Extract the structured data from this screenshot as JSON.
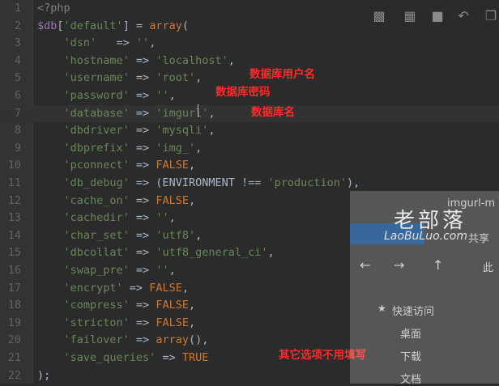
{
  "editor": {
    "lines": [
      {
        "n": "1",
        "parts": [
          {
            "t": "<?php",
            "c": "cmt"
          }
        ]
      },
      {
        "n": "2",
        "parts": [
          {
            "t": "$db",
            "c": "var"
          },
          {
            "t": "[",
            "c": ""
          },
          {
            "t": "'default'",
            "c": "str"
          },
          {
            "t": "] = ",
            "c": ""
          },
          {
            "t": "array",
            "c": "kw"
          },
          {
            "t": "(",
            "c": ""
          }
        ]
      },
      {
        "n": "3",
        "parts": [
          {
            "t": "    'dsn'   ",
            "c": "str"
          },
          {
            "t": "=> ",
            "c": ""
          },
          {
            "t": "''",
            "c": "str"
          },
          {
            "t": ",",
            "c": ""
          }
        ]
      },
      {
        "n": "4",
        "parts": [
          {
            "t": "    'hostname'",
            "c": "str"
          },
          {
            "t": " => ",
            "c": ""
          },
          {
            "t": "'localhost'",
            "c": "str"
          },
          {
            "t": ",",
            "c": ""
          }
        ]
      },
      {
        "n": "5",
        "parts": [
          {
            "t": "    'username'",
            "c": "str"
          },
          {
            "t": " => ",
            "c": ""
          },
          {
            "t": "'root'",
            "c": "str"
          },
          {
            "t": ",",
            "c": ""
          }
        ]
      },
      {
        "n": "6",
        "parts": [
          {
            "t": "    'password'",
            "c": "str"
          },
          {
            "t": " => ",
            "c": ""
          },
          {
            "t": "''",
            "c": "str"
          },
          {
            "t": ",",
            "c": ""
          }
        ]
      },
      {
        "n": "7",
        "parts": [
          {
            "t": "    'database'",
            "c": "str"
          },
          {
            "t": " => ",
            "c": ""
          },
          {
            "t": "'imgurl'",
            "c": "str"
          },
          {
            "t": ",",
            "c": ""
          }
        ]
      },
      {
        "n": "8",
        "parts": [
          {
            "t": "    'dbdriver'",
            "c": "str"
          },
          {
            "t": " => ",
            "c": ""
          },
          {
            "t": "'mysqli'",
            "c": "str"
          },
          {
            "t": ",",
            "c": ""
          }
        ]
      },
      {
        "n": "9",
        "parts": [
          {
            "t": "    'dbprefix'",
            "c": "str"
          },
          {
            "t": " => ",
            "c": ""
          },
          {
            "t": "'img_'",
            "c": "str"
          },
          {
            "t": ",",
            "c": ""
          }
        ]
      },
      {
        "n": "10",
        "parts": [
          {
            "t": "    'pconnect'",
            "c": "str"
          },
          {
            "t": " => ",
            "c": ""
          },
          {
            "t": "FALSE",
            "c": "kw"
          },
          {
            "t": ",",
            "c": ""
          }
        ]
      },
      {
        "n": "11",
        "parts": [
          {
            "t": "    'db_debug'",
            "c": "str"
          },
          {
            "t": " => (ENVIRONMENT !== ",
            "c": ""
          },
          {
            "t": "'production'",
            "c": "str"
          },
          {
            "t": "),",
            "c": ""
          }
        ]
      },
      {
        "n": "12",
        "parts": [
          {
            "t": "    'cache_on'",
            "c": "str"
          },
          {
            "t": " => ",
            "c": ""
          },
          {
            "t": "FALSE",
            "c": "kw"
          },
          {
            "t": ",",
            "c": ""
          }
        ]
      },
      {
        "n": "13",
        "parts": [
          {
            "t": "    'cachedir'",
            "c": "str"
          },
          {
            "t": " => ",
            "c": ""
          },
          {
            "t": "''",
            "c": "str"
          },
          {
            "t": ",",
            "c": ""
          }
        ]
      },
      {
        "n": "14",
        "parts": [
          {
            "t": "    'char_set'",
            "c": "str"
          },
          {
            "t": " => ",
            "c": ""
          },
          {
            "t": "'utf8'",
            "c": "str"
          },
          {
            "t": ",",
            "c": ""
          }
        ]
      },
      {
        "n": "15",
        "parts": [
          {
            "t": "    'dbcollat'",
            "c": "str"
          },
          {
            "t": " => ",
            "c": ""
          },
          {
            "t": "'utf8_general_ci'",
            "c": "str"
          },
          {
            "t": ",",
            "c": ""
          }
        ]
      },
      {
        "n": "16",
        "parts": [
          {
            "t": "    'swap_pre'",
            "c": "str"
          },
          {
            "t": " => ",
            "c": ""
          },
          {
            "t": "''",
            "c": "str"
          },
          {
            "t": ",",
            "c": ""
          }
        ]
      },
      {
        "n": "17",
        "parts": [
          {
            "t": "    'encrypt'",
            "c": "str"
          },
          {
            "t": " => ",
            "c": ""
          },
          {
            "t": "FALSE",
            "c": "kw"
          },
          {
            "t": ",",
            "c": ""
          }
        ]
      },
      {
        "n": "18",
        "parts": [
          {
            "t": "    'compress'",
            "c": "str"
          },
          {
            "t": " => ",
            "c": ""
          },
          {
            "t": "FALSE",
            "c": "kw"
          },
          {
            "t": ",",
            "c": ""
          }
        ]
      },
      {
        "n": "19",
        "parts": [
          {
            "t": "    'stricton'",
            "c": "str"
          },
          {
            "t": " => ",
            "c": ""
          },
          {
            "t": "FALSE",
            "c": "kw"
          },
          {
            "t": ",",
            "c": ""
          }
        ]
      },
      {
        "n": "20",
        "parts": [
          {
            "t": "    'failover'",
            "c": "str"
          },
          {
            "t": " => ",
            "c": ""
          },
          {
            "t": "array",
            "c": "kw"
          },
          {
            "t": "(),",
            "c": ""
          }
        ]
      },
      {
        "n": "21",
        "parts": [
          {
            "t": "    'save_queries'",
            "c": "str"
          },
          {
            "t": " => ",
            "c": ""
          },
          {
            "t": "TRUE",
            "c": "kw"
          }
        ]
      },
      {
        "n": "22",
        "parts": [
          {
            "t": ");",
            "c": ""
          }
        ]
      }
    ],
    "highlighted_line": "7"
  },
  "annotations": {
    "username_note": "数据库用户名",
    "password_note": "数据库密码",
    "database_note": "数据库名",
    "other_note": "其它选项不用填写"
  },
  "explorer": {
    "title_fragment": "imgurl-m",
    "share_label": "共享",
    "path_fragment": "此",
    "quick_access": "快速访问",
    "desktop": "桌面",
    "downloads": "下载",
    "documents": "文档"
  },
  "watermark": {
    "cn": "老部落",
    "en": "LaoBuLuo.com"
  },
  "colors": {
    "background": "#2b2b2b",
    "gutter": "#313335",
    "keyword": "#cc7832",
    "string": "#6a8759",
    "variable": "#9876aa",
    "annotation": "#ff2a2a"
  }
}
